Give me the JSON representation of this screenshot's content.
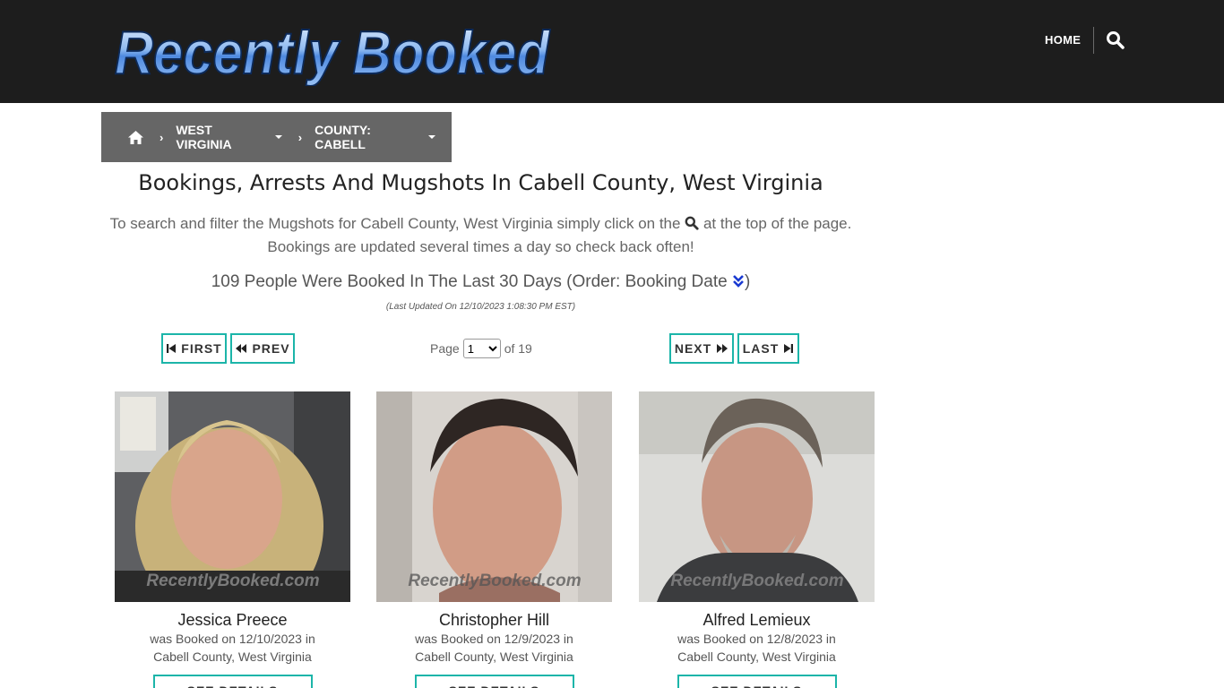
{
  "header": {
    "logo_text": "Recently Booked",
    "nav_home": "HOME",
    "search_icon": "search-icon"
  },
  "breadcrumb": {
    "home_icon": "home-icon",
    "state": "WEST VIRGINIA",
    "county": "COUNTY: CABELL"
  },
  "main": {
    "title": "Bookings, Arrests And Mugshots In Cabell County, West Virginia",
    "intro_part1": "To search and filter the Mugshots for Cabell County, West Virginia simply click on the",
    "intro_part2": "at the top of the page.",
    "intro_line2": "Bookings are updated several times a day so check back often!",
    "count_text": "109 People Were Booked In The Last 30 Days (Order: Booking Date",
    "count_close": ")",
    "updated": "(Last Updated On 12/10/2023 1:08:30 PM EST)"
  },
  "pager": {
    "first": "FIRST",
    "prev": "PREV",
    "next": "NEXT",
    "last": "LAST",
    "page_label": "Page",
    "page_value": "1",
    "of_label": "of 19"
  },
  "cards": [
    {
      "name": "Jessica Preece",
      "booked": "was Booked on 12/10/2023 in",
      "location": "Cabell County, West Virginia",
      "button": "SEE DETAILS",
      "watermark": "RecentlyBooked.com"
    },
    {
      "name": "Christopher Hill",
      "booked": "was Booked on 12/9/2023 in",
      "location": "Cabell County, West Virginia",
      "button": "SEE DETAILS",
      "watermark": "RecentlyBooked.com"
    },
    {
      "name": "Alfred Lemieux",
      "booked": "was Booked on 12/8/2023 in",
      "location": "Cabell County, West Virginia",
      "button": "SEE DETAILS",
      "watermark": "RecentlyBooked.com"
    }
  ],
  "colors": {
    "header_bg": "#1d1d1d",
    "breadcrumb_bg": "#666666",
    "button_border": "#1cb5a9",
    "sort_icon": "#1a3ad1"
  }
}
